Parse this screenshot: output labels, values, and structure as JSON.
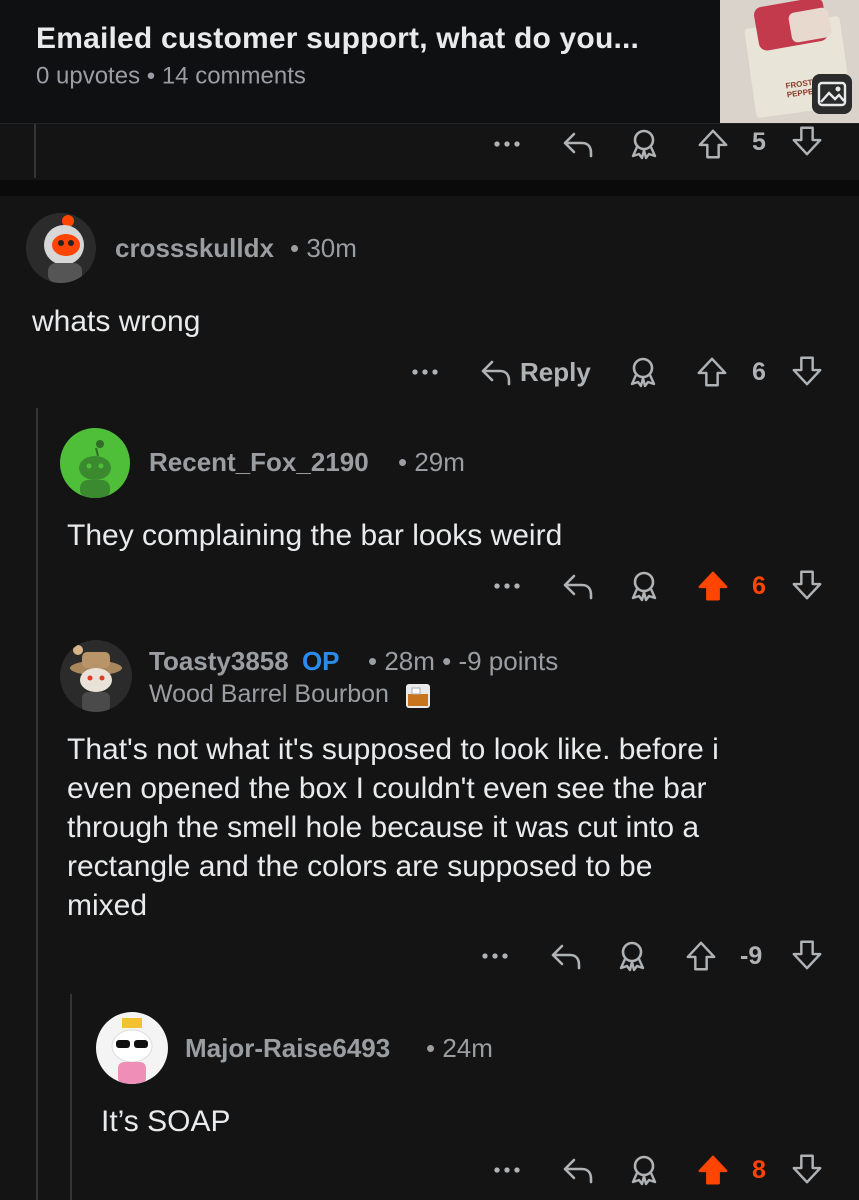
{
  "post": {
    "title": "Emailed customer support, what do you...",
    "upvotes": "0 upvotes",
    "comments": "14 comments",
    "thumb_label": "FROSTY\nPEPPERMINT"
  },
  "top_actions": {
    "votes": "5"
  },
  "colors": {
    "upvote": "#ff4500",
    "op": "#2a8bea",
    "background": "#141414"
  },
  "comments": [
    {
      "username": "crossskulldx",
      "age": "30m",
      "body": "whats wrong",
      "reply_label": "Reply",
      "votes": "6",
      "upvoted": false
    },
    {
      "username": "Recent_Fox_2190",
      "age": "29m",
      "body": "They complaining the bar looks weird",
      "votes": "6",
      "upvoted": true
    },
    {
      "username": "Toasty3858",
      "op_badge": "OP",
      "age": "28m",
      "points": "-9 points",
      "flair": "Wood Barrel Bourbon",
      "body_lines": [
        "That's not what it's supposed to look like. before i",
        "even opened the box I couldn't even see the bar",
        "through the smell hole because it was cut into a",
        "rectangle and the colors are supposed to be",
        "mixed"
      ],
      "votes": "-9",
      "upvoted": false
    },
    {
      "username": "Major-Raise6493",
      "age": "24m",
      "body": "It’s SOAP",
      "votes": "8",
      "upvoted": true
    }
  ],
  "icons": {
    "more": "more-icon",
    "reply": "reply-icon",
    "award": "award-icon",
    "upvote": "upvote-icon",
    "downvote": "downvote-icon",
    "image": "image-icon"
  }
}
